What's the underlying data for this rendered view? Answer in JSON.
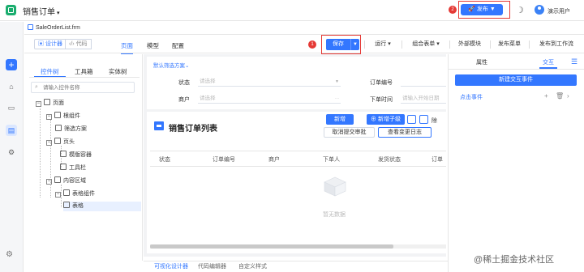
{
  "app": {
    "title": "销售订单",
    "user": "演示用户",
    "publish": "发布"
  },
  "badges": {
    "save": "1",
    "publish": "2"
  },
  "file_tab": "SaleOrderList.frm",
  "toolbar": {
    "designer": "设计器",
    "code": "代码",
    "tabs": [
      "页面",
      "模型",
      "配置"
    ],
    "save": "保存",
    "run": "运行",
    "combo_form": "组合表单",
    "external_module": "外部模块",
    "publish_menu": "发布菜单",
    "publish_workflow": "发布到工作流"
  },
  "left_panel": {
    "tabs": [
      "控件树",
      "工具箱",
      "实体树"
    ],
    "search_placeholder": "请输入控件名称",
    "tree": [
      {
        "label": "页面"
      },
      {
        "label": "根组件"
      },
      {
        "label": "筛选方案"
      },
      {
        "label": "页头"
      },
      {
        "label": "模版容器"
      },
      {
        "label": "工具栏"
      },
      {
        "label": "内容区域"
      },
      {
        "label": "表格组件"
      },
      {
        "label": "表格"
      }
    ]
  },
  "form": {
    "scheme": "默认筛选方案",
    "status_label": "状态",
    "status_placeholder": "请选择",
    "order_no_label": "订单编号",
    "merchant_label": "商户",
    "merchant_placeholder": "请选择",
    "order_time_label": "下单时间",
    "order_time_placeholder": "请输入开始日期"
  },
  "list": {
    "title": "销售订单列表",
    "btn_new": "新增",
    "btn_new_child": "新增子级",
    "btn_delete": "除",
    "btn_cancel_submit": "取消提交审批",
    "btn_view_log": "查看变更日志",
    "columns": [
      "状态",
      "订单编号",
      "商户",
      "下单人",
      "发货状态",
      "订单"
    ],
    "empty": "暂无数据"
  },
  "right_panel": {
    "tabs": [
      "属性",
      "交互"
    ],
    "new_event": "新建交互事件",
    "click_event": "点击事件"
  },
  "bottom_tabs": [
    "可视化设计器",
    "代码编辑器",
    "自定义样式"
  ],
  "watermark": "@稀土掘金技术社区",
  "colors": {
    "accent": "#3377ff",
    "highlight": "#e53935",
    "logo": "#1aad6e"
  }
}
